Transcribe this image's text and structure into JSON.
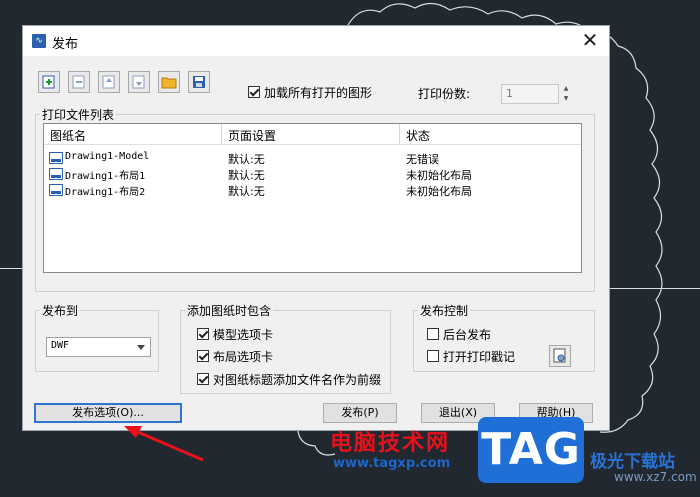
{
  "dialog": {
    "title": "发布",
    "load_all_label": "加载所有打开的图形",
    "copies_label": "打印份数:",
    "copies_value": "1"
  },
  "file_list": {
    "group_title": "打印文件列表",
    "columns": [
      "图纸名",
      "页面设置",
      "状态"
    ],
    "rows": [
      {
        "name": "Drawing1-Model",
        "setup": "默认:无",
        "status": "无错误"
      },
      {
        "name": "Drawing1-布局1",
        "setup": "默认:无",
        "status": "未初始化布局"
      },
      {
        "name": "Drawing1-布局2",
        "setup": "默认:无",
        "status": "未初始化布局"
      }
    ]
  },
  "publish_to": {
    "group_title": "发布到",
    "selected": "DWF"
  },
  "include": {
    "group_title": "添加图纸时包含",
    "model_tab": "模型选项卡",
    "layout_tab": "布局选项卡",
    "prefix": "对图纸标题添加文件名作为前缀"
  },
  "control": {
    "group_title": "发布控制",
    "background": "后台发布",
    "stamp": "打开打印戳记"
  },
  "buttons": {
    "options": "发布选项(O)...",
    "publish": "发布(P)",
    "exit": "退出(X)",
    "help": "帮助(H)"
  },
  "watermark": {
    "site_cn": "电脑技术网",
    "site_url": "www.tagxp.com",
    "tag": "TAG",
    "xz_cn": "极光下载站",
    "xz_url": "www.xz7.com"
  },
  "colors": {
    "dialog_bg": "#f0f0f0",
    "desktop_bg": "#212830",
    "accent_blue": "#2f74d0",
    "watermark_red": "#e8101a",
    "arrow_red": "#e8101a"
  }
}
